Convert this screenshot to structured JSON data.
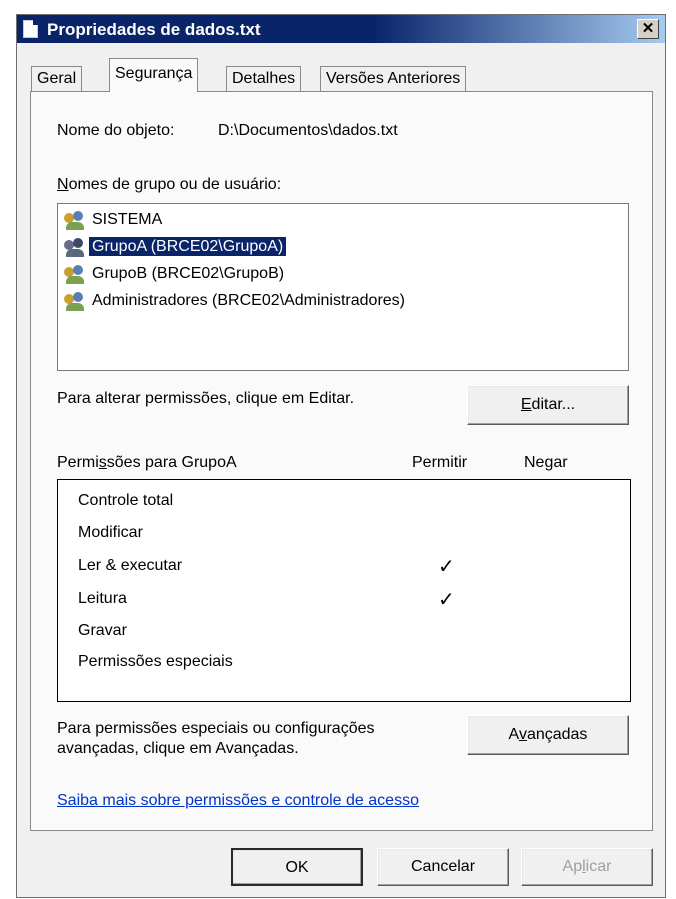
{
  "window": {
    "title": "Propriedades de dados.txt",
    "close_glyph": "✕"
  },
  "tabs": [
    {
      "label": "Geral",
      "active": false
    },
    {
      "label": "Segurança",
      "active": true
    },
    {
      "label": "Detalhes",
      "active": false
    },
    {
      "label": "Versões Anteriores",
      "active": false
    }
  ],
  "object": {
    "label": "Nome do objeto:",
    "value": "D:\\Documentos\\dados.txt"
  },
  "groups": {
    "label_accel": "N",
    "label_rest": "omes de grupo ou de usuário:",
    "items": [
      {
        "label": "SISTEMA",
        "icon": "users-group-icon",
        "selected": false
      },
      {
        "label": "GrupoA (BRCE02\\GrupoA)",
        "icon": "users-group-icon",
        "selected": true
      },
      {
        "label": "GrupoB (BRCE02\\GrupoB)",
        "icon": "users-group-icon",
        "selected": false
      },
      {
        "label": "Administradores (BRCE02\\Administradores)",
        "icon": "users-group-icon",
        "selected": false
      }
    ]
  },
  "edit": {
    "hint": "Para alterar permissões, clique em Editar.",
    "button_accel": "E",
    "button_rest": "ditar..."
  },
  "permissions": {
    "label_pre": "Permi",
    "label_accel": "s",
    "label_post": "sões para GrupoA",
    "col_allow": "Permitir",
    "col_deny": "Negar",
    "check_glyph": "✓",
    "rows": [
      {
        "name": "Controle total",
        "allow": false,
        "deny": false
      },
      {
        "name": "Modificar",
        "allow": false,
        "deny": false
      },
      {
        "name": "Ler & executar",
        "allow": true,
        "deny": false
      },
      {
        "name": "Leitura",
        "allow": true,
        "deny": false
      },
      {
        "name": "Gravar",
        "allow": false,
        "deny": false
      },
      {
        "name": "Permissões especiais",
        "allow": false,
        "deny": false
      }
    ]
  },
  "advanced": {
    "hint_line1": "Para permissões especiais ou configurações",
    "hint_line2": "avançadas, clique em Avançadas.",
    "button_pre": "A",
    "button_accel": "v",
    "button_post": "ançadas"
  },
  "learn_more": "Saiba mais sobre permissões e controle de acesso",
  "footer": {
    "ok": "OK",
    "cancel": "Cancelar",
    "apply_pre": "Ap",
    "apply_accel": "l",
    "apply_post": "icar"
  },
  "colors": {
    "selection": "#0a246a",
    "link": "#0033cc",
    "title_bar": "#0a246a"
  }
}
